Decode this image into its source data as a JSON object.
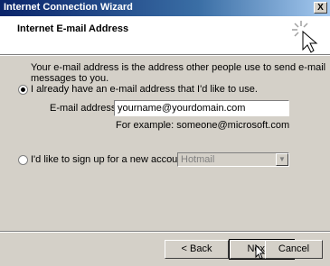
{
  "window": {
    "title": "Internet Connection Wizard",
    "close_glyph": "X"
  },
  "header": {
    "title": "Internet E-mail Address",
    "icon": "wizard-cursor-icon"
  },
  "main": {
    "description": "Your e-mail address is the address other people use to send e-mail messages to you.",
    "option_existing": {
      "label": "I already have an e-mail address that I'd like to use.",
      "selected": true
    },
    "email_label": "E-mail address:",
    "email_value": "yourname@yourdomain.com",
    "example_text": "For example: someone@microsoft.com",
    "option_signup": {
      "label": "I'd like to sign up for a new account from:",
      "selected": false
    },
    "provider_value": "Hotmail"
  },
  "buttons": {
    "back": "< Back",
    "next": "Next >",
    "cancel": "Cancel"
  }
}
